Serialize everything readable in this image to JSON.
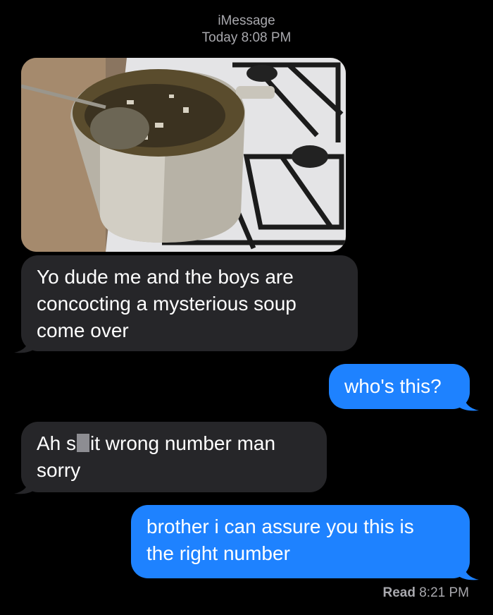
{
  "header": {
    "service": "iMessage",
    "timestamp": "Today 8:08 PM"
  },
  "attachment": {
    "icon": "photo-attachment"
  },
  "messages": [
    {
      "direction": "incoming",
      "lines": [
        "Yo dude me and the boys are",
        "concocting a mysterious soup",
        "come over"
      ]
    },
    {
      "direction": "outgoing",
      "lines": [
        "who's this?"
      ]
    },
    {
      "direction": "incoming",
      "line1_before": "Ah s",
      "line1_after": "it wrong number man",
      "line2": "sorry"
    },
    {
      "direction": "outgoing",
      "lines": [
        "brother i can assure you this is",
        "the right number"
      ]
    }
  ],
  "receipt": {
    "label": "Read",
    "time": "8:21 PM"
  },
  "colors": {
    "background": "#000000",
    "incoming_bubble": "#262629",
    "outgoing_bubble": "#1e82ff",
    "meta_text": "#a8a8ad"
  }
}
